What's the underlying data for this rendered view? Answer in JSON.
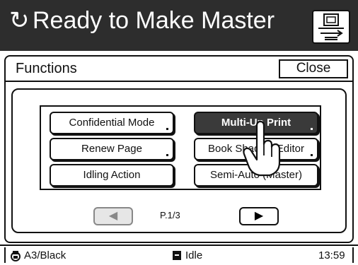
{
  "header": {
    "title": "Ready to Make Master",
    "status_icon": "circular-arrow-icon",
    "mode_button_icon": "master-print-switch-icon"
  },
  "panel": {
    "title": "Functions",
    "close_label": "Close"
  },
  "functions": [
    {
      "label": "Confidential Mode",
      "selected": false
    },
    {
      "label": "Multi-Up Print",
      "selected": true
    },
    {
      "label": "Renew Page",
      "selected": false
    },
    {
      "label": "Book Shadow Editor",
      "selected": false
    },
    {
      "label": "Idling Action",
      "selected": false
    },
    {
      "label": "Semi-Auto (Master)",
      "selected": false
    }
  ],
  "pagination": {
    "prev_icon": "left-triangle-icon",
    "next_icon": "right-triangle-icon",
    "page_indicator": "P.1/3"
  },
  "statusbar": {
    "printer_info": "A3/Black",
    "state": "Idle",
    "time": "13:59"
  },
  "colors": {
    "header_bg": "#2d2d2d",
    "selected_bg": "#3a3a3a"
  }
}
